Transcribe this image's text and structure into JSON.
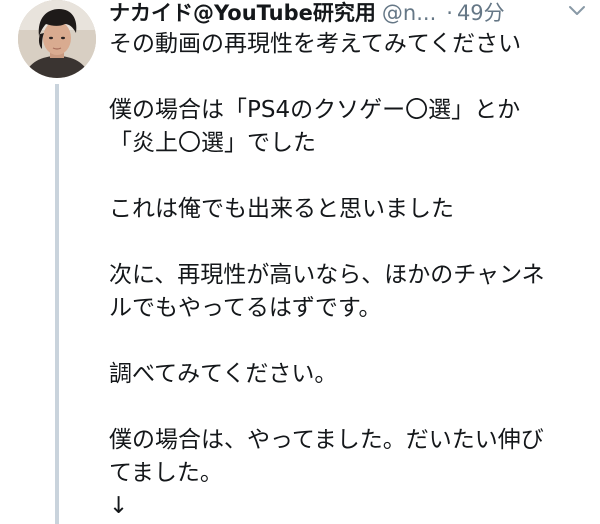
{
  "tweet": {
    "author": {
      "display_name": "ナカイド@YouTube研究用",
      "handle": "@n...",
      "avatar_icon": "user-avatar-photo"
    },
    "separator": "·",
    "time": "49分",
    "menu_icon": "chevron-down-icon",
    "body": {
      "p1": {
        "l1": "その動画の再現性を考えてみてください"
      },
      "p2": {
        "l1": "僕の場合は「PS4のクソゲー〇選」とか",
        "l2": "「炎上〇選」でした"
      },
      "p3": {
        "l1": "これは俺でも出来ると思いました"
      },
      "p4": {
        "l1": "次に、再現性が高いなら、ほかのチャンネ",
        "l2": "ルでもやってるはずです。"
      },
      "p5": {
        "l1": "調べてみてください。"
      },
      "p6": {
        "l1": "僕の場合は、やってました。だいたい伸び",
        "l2": "てました。",
        "l3": "↓"
      }
    }
  },
  "colors": {
    "text": "#14171a",
    "secondary": "#657786",
    "thread_line": "#c9d3dc"
  }
}
